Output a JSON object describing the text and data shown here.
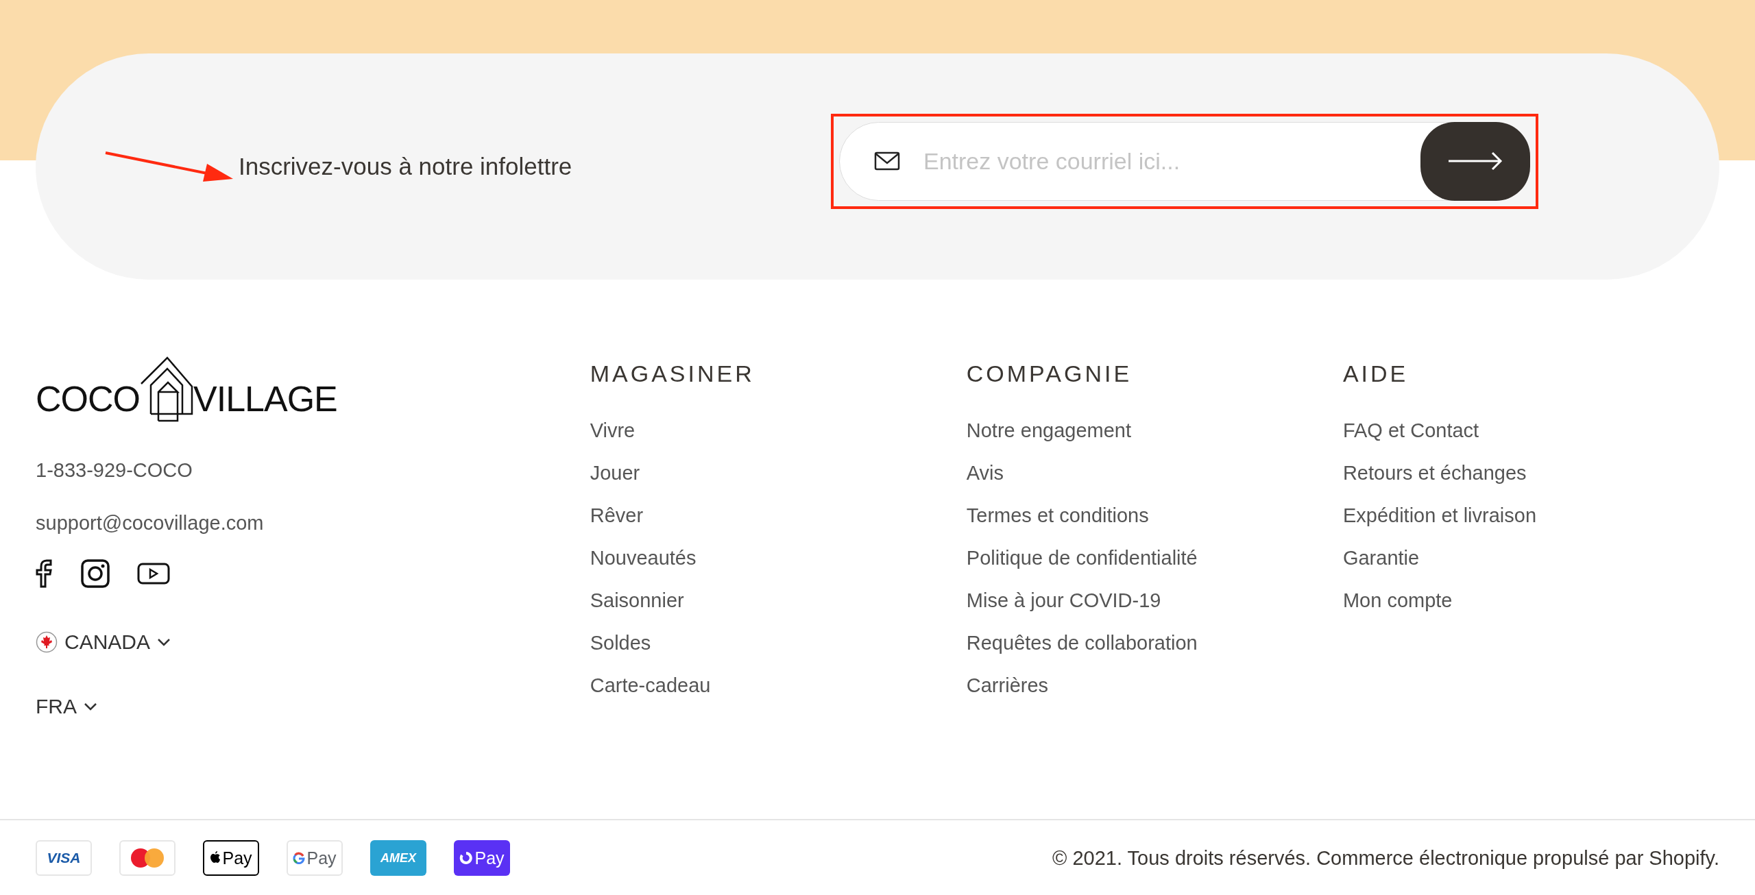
{
  "newsletter": {
    "label": "Inscrivez-vous à notre infolettre",
    "email_field": {
      "placeholder": "Entrez votre courriel ici..."
    }
  },
  "brand": {
    "logo_left": "COCO",
    "logo_right": "VILLAGE",
    "phone": "1-833-929-COCO",
    "email": "support@cocovillage.com"
  },
  "social": [
    {
      "kind": "facebook"
    },
    {
      "kind": "instagram"
    },
    {
      "kind": "youtube"
    }
  ],
  "country_selector": {
    "label": "CANADA"
  },
  "language_selector": {
    "label": "FRA"
  },
  "columns": [
    {
      "heading": "MAGASINER",
      "links": [
        "Vivre",
        "Jouer",
        "Rêver",
        "Nouveautés",
        "Saisonnier",
        "Soldes",
        "Carte-cadeau"
      ]
    },
    {
      "heading": "COMPAGNIE",
      "links": [
        "Notre engagement",
        "Avis",
        "Termes et conditions",
        "Politique de confidentialité",
        "Mise à jour COVID-19",
        "Requêtes de collaboration",
        "Carrières"
      ]
    },
    {
      "heading": "AIDE",
      "links": [
        "FAQ et Contact",
        "Retours et échanges",
        "Expédition et livraison",
        "Garantie",
        "Mon compte"
      ]
    }
  ],
  "payments": [
    {
      "kind": "visa",
      "label": "VISA"
    },
    {
      "kind": "mastercard"
    },
    {
      "kind": "applepay",
      "label": "Pay"
    },
    {
      "kind": "googlepay",
      "label": "Pay"
    },
    {
      "kind": "amex",
      "label": "AMEX"
    },
    {
      "kind": "shoppay",
      "label": "Pay"
    }
  ],
  "copyright": "© 2021. Tous droits réservés. Commerce électronique propulsé par Shopify."
}
